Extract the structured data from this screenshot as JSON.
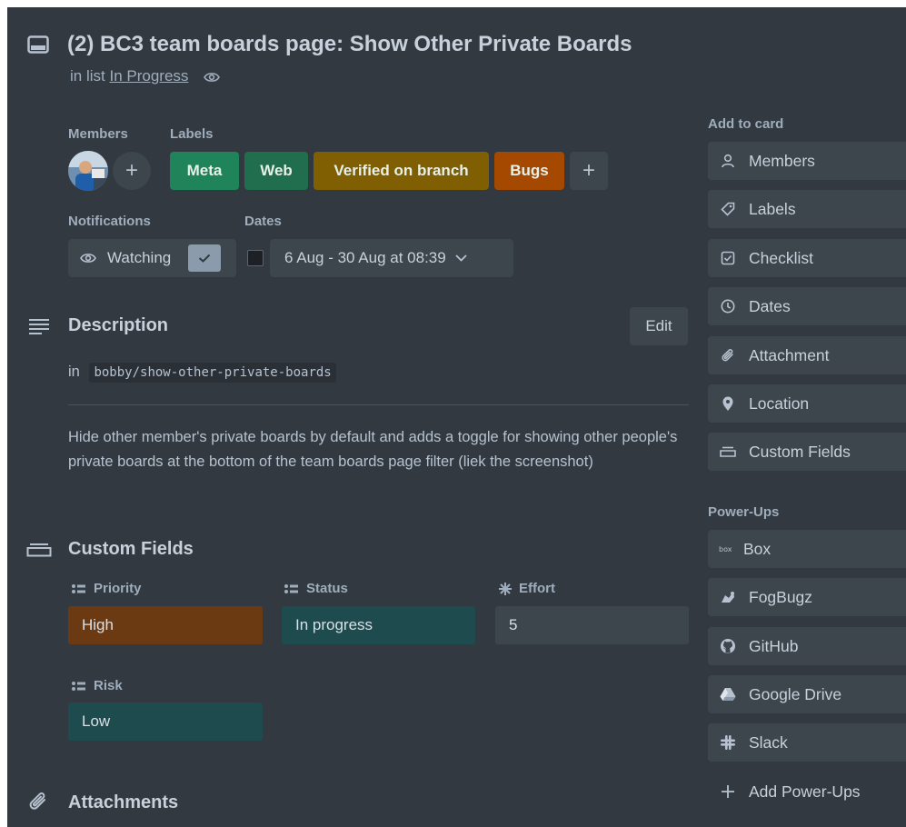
{
  "card": {
    "title": "(2) BC3 team boards page: Show Other Private Boards",
    "in_list_prefix": "in list",
    "list_name": "In Progress"
  },
  "members": {
    "label": "Members"
  },
  "labels": {
    "label": "Labels",
    "items": [
      {
        "text": "Meta",
        "color": "#1f845a"
      },
      {
        "text": "Web",
        "color": "#216e4e"
      },
      {
        "text": "Verified on branch",
        "color": "#7f5f01"
      },
      {
        "text": "Bugs",
        "color": "#a54800"
      }
    ]
  },
  "notifications": {
    "label": "Notifications",
    "watch_label": "Watching"
  },
  "dates": {
    "label": "Dates",
    "value": "6 Aug - 30 Aug at 08:39"
  },
  "description": {
    "heading": "Description",
    "edit_label": "Edit",
    "branch_prefix": "in",
    "branch": "bobby/show-other-private-boards",
    "text": "Hide other member's private boards by default and adds a toggle for showing other people's private boards at the bottom of the team boards page filter (liek the screenshot)"
  },
  "custom_fields": {
    "heading": "Custom Fields",
    "fields": [
      {
        "label": "Priority",
        "value": "High",
        "color": "#6b3a12",
        "icon": "list-icon"
      },
      {
        "label": "Status",
        "value": "In progress",
        "color": "#1e4b4e",
        "icon": "list-icon"
      },
      {
        "label": "Effort",
        "value": "5",
        "color": "#3d454d",
        "icon": "asterisk-icon"
      },
      {
        "label": "Risk",
        "value": "Low",
        "color": "#1e4b4e",
        "icon": "list-icon"
      }
    ]
  },
  "attachments": {
    "heading": "Attachments"
  },
  "sidebar": {
    "add_to_card_label": "Add to card",
    "add_items": [
      {
        "label": "Members",
        "icon": "person-icon"
      },
      {
        "label": "Labels",
        "icon": "tag-icon"
      },
      {
        "label": "Checklist",
        "icon": "checklist-icon"
      },
      {
        "label": "Dates",
        "icon": "clock-icon"
      },
      {
        "label": "Attachment",
        "icon": "paperclip-icon"
      },
      {
        "label": "Location",
        "icon": "location-pin-icon"
      },
      {
        "label": "Custom Fields",
        "icon": "custom-fields-icon"
      }
    ],
    "powerups_label": "Power-Ups",
    "powerups": [
      {
        "label": "Box",
        "icon": "box-logo-icon"
      },
      {
        "label": "FogBugz",
        "icon": "fogbugz-logo-icon"
      },
      {
        "label": "GitHub",
        "icon": "github-logo-icon"
      },
      {
        "label": "Google Drive",
        "icon": "google-drive-logo-icon"
      },
      {
        "label": "Slack",
        "icon": "slack-logo-icon"
      }
    ],
    "add_powerups_label": "Add Power-Ups"
  }
}
